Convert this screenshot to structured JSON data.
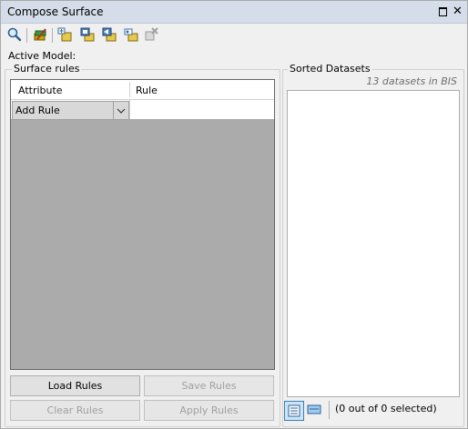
{
  "window": {
    "title": "Compose Surface"
  },
  "toolbar": {
    "icons": [
      "search-icon",
      "edit-rules-icon",
      "dataset-add-icon",
      "dataset-stack-icon",
      "dataset-move-icon",
      "dataset-key-icon",
      "dataset-remove-icon"
    ]
  },
  "active_model": {
    "label": "Active Model:"
  },
  "surface_rules": {
    "group_label": "Surface rules",
    "columns": [
      "Attribute",
      "Rule"
    ],
    "row": {
      "attribute": "Add Rule",
      "rule": ""
    }
  },
  "buttons": {
    "load": "Load Rules",
    "save": "Save Rules",
    "clear": "Clear Rules",
    "apply": "Apply Rules"
  },
  "sorted_datasets": {
    "group_label": "Sorted Datasets",
    "count_text": "13 datasets in BIS",
    "status": "(0 out of 0 selected)"
  },
  "colors": {
    "titlebar": "#d4dde9",
    "grid_bg": "#ababab",
    "accent": "#3c7fb1"
  }
}
